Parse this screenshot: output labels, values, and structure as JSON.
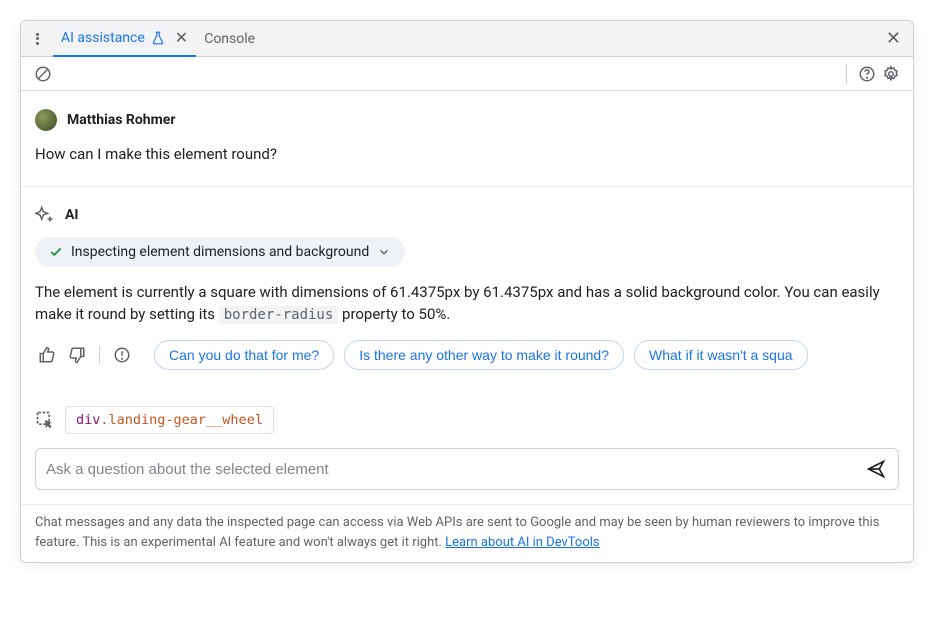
{
  "tabs": {
    "ai": "AI assistance",
    "console": "Console"
  },
  "user": {
    "name": "Matthias Rohmer",
    "question": "How can I make this element round?"
  },
  "ai": {
    "label": "AI",
    "status": "Inspecting element dimensions and background",
    "response_pre": "The element is currently a square with dimensions of 61.4375px by 61.4375px and has a solid background color. You can easily make it round by setting its ",
    "response_code": "border-radius",
    "response_post": " property to 50%."
  },
  "suggestions": [
    "Can you do that for me?",
    "Is there any other way to make it round?",
    "What if it wasn't a squa"
  ],
  "context": {
    "tag": "div",
    "cls": ".landing-gear__wheel"
  },
  "input": {
    "placeholder": "Ask a question about the selected element"
  },
  "footer": {
    "text": "Chat messages and any data the inspected page can access via Web APIs are sent to Google and may be seen by human reviewers to improve this feature. This is an experimental AI feature and won't always get it right. ",
    "link": "Learn about AI in DevTools"
  }
}
